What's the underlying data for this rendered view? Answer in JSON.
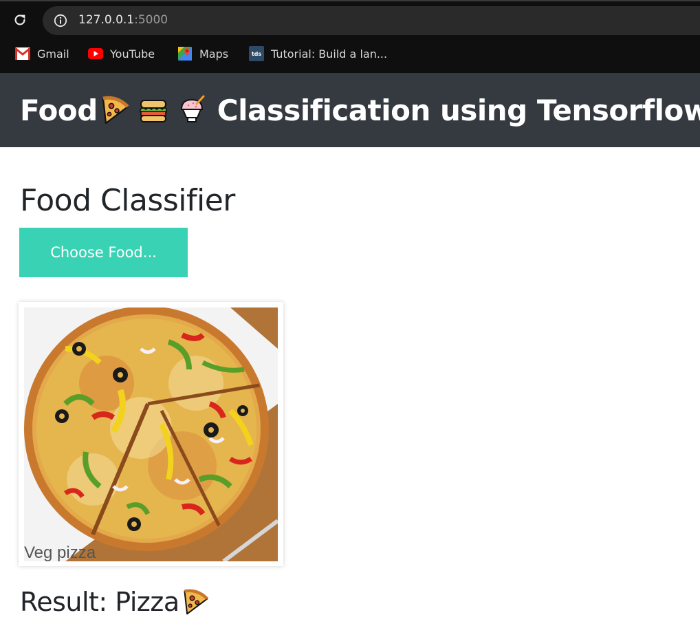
{
  "browser": {
    "url_host": "127.0.0.1",
    "url_port": ":5000",
    "bookmarks": [
      {
        "label": "Gmail",
        "icon": "gmail-icon"
      },
      {
        "label": "YouTube",
        "icon": "youtube-icon"
      },
      {
        "label": "Maps",
        "icon": "maps-icon"
      },
      {
        "label": "Tutorial: Build a lan...",
        "icon": "tds-icon",
        "icon_text": "tds"
      }
    ]
  },
  "header": {
    "title_prefix": "Food",
    "title_suffix": "Classification using Tensorflow",
    "emojis": [
      "pizza-emoji",
      "sandwich-emoji",
      "shaved-ice-emoji"
    ]
  },
  "main": {
    "heading": "Food Classifier",
    "choose_button_label": "Choose Food...",
    "image": {
      "subject": "pizza photo",
      "caption": "Veg pizza"
    },
    "result_text": "Result: Pizza",
    "result_emoji": "pizza-emoji"
  },
  "colors": {
    "header_bg": "#343a40",
    "button_bg": "#39d2b4",
    "text": "#212529"
  }
}
